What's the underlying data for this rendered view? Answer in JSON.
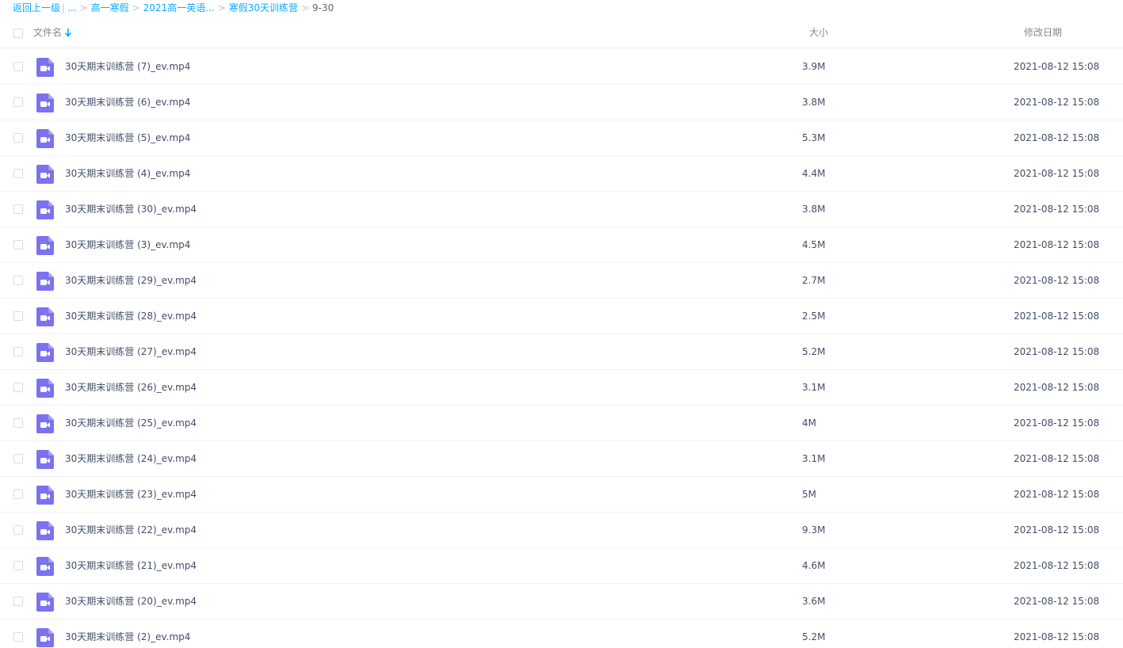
{
  "breadcrumb": {
    "back": "返回上一级",
    "ellipsis": "...",
    "items": [
      "高一寒假",
      "2021高一英语...",
      "寒假30天训练营"
    ],
    "current": "9-30"
  },
  "header": {
    "name": "文件名",
    "size": "大小",
    "date": "修改日期"
  },
  "colors": {
    "link": "#09aaff",
    "video_icon": "#7b72f0"
  },
  "files": [
    {
      "name": "30天期末训练营 (7)_ev.mp4",
      "size": "3.9M",
      "date": "2021-08-12 15:08",
      "icon": "video-file-icon"
    },
    {
      "name": "30天期末训练营 (6)_ev.mp4",
      "size": "3.8M",
      "date": "2021-08-12 15:08",
      "icon": "video-file-icon"
    },
    {
      "name": "30天期末训练营 (5)_ev.mp4",
      "size": "5.3M",
      "date": "2021-08-12 15:08",
      "icon": "video-file-icon"
    },
    {
      "name": "30天期末训练营 (4)_ev.mp4",
      "size": "4.4M",
      "date": "2021-08-12 15:08",
      "icon": "video-file-icon"
    },
    {
      "name": "30天期末训练营 (30)_ev.mp4",
      "size": "3.8M",
      "date": "2021-08-12 15:08",
      "icon": "video-file-icon"
    },
    {
      "name": "30天期末训练营 (3)_ev.mp4",
      "size": "4.5M",
      "date": "2021-08-12 15:08",
      "icon": "video-file-icon"
    },
    {
      "name": "30天期末训练营 (29)_ev.mp4",
      "size": "2.7M",
      "date": "2021-08-12 15:08",
      "icon": "video-file-icon"
    },
    {
      "name": "30天期末训练营 (28)_ev.mp4",
      "size": "2.5M",
      "date": "2021-08-12 15:08",
      "icon": "video-file-icon"
    },
    {
      "name": "30天期末训练营 (27)_ev.mp4",
      "size": "5.2M",
      "date": "2021-08-12 15:08",
      "icon": "video-file-icon"
    },
    {
      "name": "30天期末训练营 (26)_ev.mp4",
      "size": "3.1M",
      "date": "2021-08-12 15:08",
      "icon": "video-file-icon"
    },
    {
      "name": "30天期末训练营 (25)_ev.mp4",
      "size": "4M",
      "date": "2021-08-12 15:08",
      "icon": "video-file-icon"
    },
    {
      "name": "30天期末训练营 (24)_ev.mp4",
      "size": "3.1M",
      "date": "2021-08-12 15:08",
      "icon": "video-file-icon"
    },
    {
      "name": "30天期末训练营 (23)_ev.mp4",
      "size": "5M",
      "date": "2021-08-12 15:08",
      "icon": "video-file-icon"
    },
    {
      "name": "30天期末训练营 (22)_ev.mp4",
      "size": "9.3M",
      "date": "2021-08-12 15:08",
      "icon": "video-file-icon"
    },
    {
      "name": "30天期末训练营 (21)_ev.mp4",
      "size": "4.6M",
      "date": "2021-08-12 15:08",
      "icon": "video-file-icon"
    },
    {
      "name": "30天期末训练营 (20)_ev.mp4",
      "size": "3.6M",
      "date": "2021-08-12 15:08",
      "icon": "video-file-icon"
    },
    {
      "name": "30天期末训练营 (2)_ev.mp4",
      "size": "5.2M",
      "date": "2021-08-12 15:08",
      "icon": "video-file-icon"
    }
  ]
}
